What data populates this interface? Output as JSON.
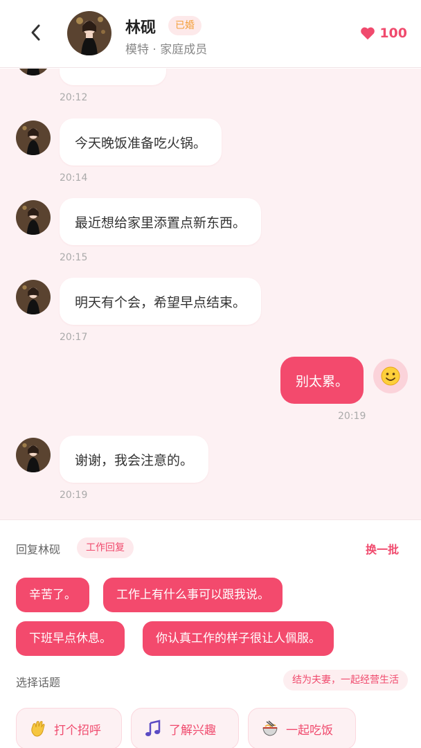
{
  "header": {
    "contact_name": "林砚",
    "status_badge": "已婚",
    "subtitle": "模特 · 家庭成员",
    "likes_count": "100"
  },
  "messages": [
    {
      "from": "contact",
      "text": "今天晚饭准备吃火锅。",
      "time": "20:14"
    },
    {
      "from": "contact",
      "text": "最近想给家里添置点新东西。",
      "time": "20:15"
    },
    {
      "from": "contact",
      "text": "明天有个会，希望早点结束。",
      "time": "20:17"
    },
    {
      "from": "me",
      "text": "别太累。",
      "time": "20:19"
    },
    {
      "from": "contact",
      "text": "谢谢，我会注意的。",
      "time": "20:19"
    }
  ],
  "partial_message_time": "20:12",
  "reply_panel": {
    "label": "回复林砚",
    "tag": "工作回复",
    "refresh_label": "换一批",
    "quick_replies": [
      "辛苦了。",
      "工作上有什么事可以跟我说。",
      "下班早点休息。",
      "你认真工作的样子很让人佩服。"
    ]
  },
  "topic_panel": {
    "label": "选择话题",
    "tag": "结为夫妻，一起经营生活",
    "topics": [
      {
        "label": "打个招呼",
        "icon": "waving-hand-icon"
      },
      {
        "label": "了解兴趣",
        "icon": "music-note-icon"
      },
      {
        "label": "一起吃饭",
        "icon": "noodle-bowl-icon"
      }
    ]
  },
  "colors": {
    "accent": "#f34a6d",
    "chat_background": "#fdf1f3",
    "badge_text": "#f3a03b"
  }
}
